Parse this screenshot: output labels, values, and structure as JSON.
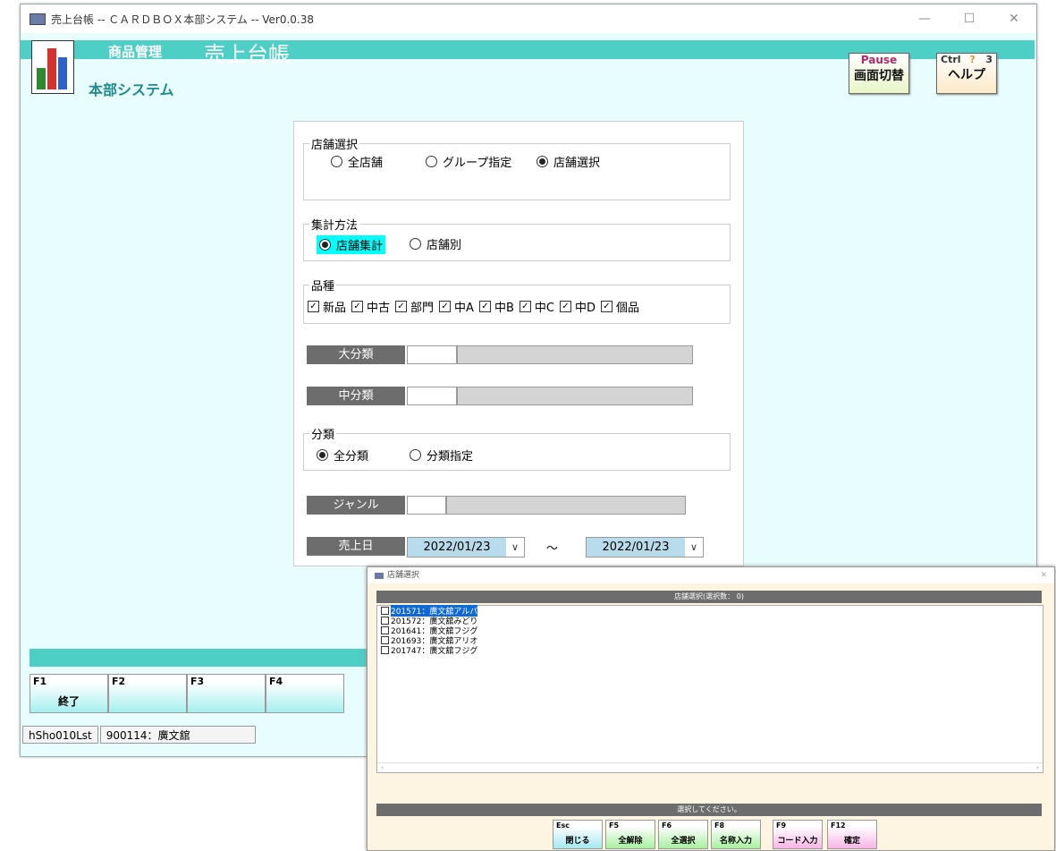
{
  "window": {
    "title": "売上台帳 -- ＣＡＲＤＢＯＸ本部システム -- Ver0.0.38",
    "min": "—",
    "max": "☐",
    "close": "✕"
  },
  "header": {
    "category": "商品管理",
    "title": "売上台帳",
    "subtitle": "本部システム",
    "screen_switch": {
      "key": "Pause",
      "label": "画面切替"
    },
    "help": {
      "key": "Ctrl",
      "num": "3",
      "label": "ヘルプ"
    }
  },
  "store_select": {
    "legend": "店舗選択",
    "options": [
      "全店舗",
      "グループ指定",
      "店舗選択"
    ],
    "selected": "店舗選択"
  },
  "aggregation": {
    "legend": "集計方法",
    "options": [
      "店舗集計",
      "店舗別"
    ],
    "selected": "店舗集計"
  },
  "product_type": {
    "legend": "品種",
    "items": [
      "新品",
      "中古",
      "部門",
      "中A",
      "中B",
      "中C",
      "中D",
      "個品"
    ]
  },
  "fields": {
    "major_class": "大分類",
    "middle_class": "中分類",
    "genre": "ジャンル",
    "sales_date": "売上日",
    "date_from": "2022/01/23",
    "date_to": "2022/01/23",
    "tilde": "～"
  },
  "classification": {
    "legend": "分類",
    "options": [
      "全分類",
      "分類指定"
    ],
    "selected": "全分類"
  },
  "fkeys": [
    {
      "num": "F1",
      "label": "終了"
    },
    {
      "num": "F2",
      "label": ""
    },
    {
      "num": "F3",
      "label": ""
    },
    {
      "num": "F4",
      "label": ""
    }
  ],
  "status": {
    "program": "hSho010Lst",
    "store": "900114：廣文舘"
  },
  "dialog": {
    "title": "店舗選択",
    "header": "店舗選択(選択数： 0)",
    "items": [
      "201571：廣文舘アルパ",
      "201572：廣文舘みどり",
      "201641：廣文舘フジグ",
      "201693：廣文舘アリオ",
      "201747：廣文舘フジグ"
    ],
    "message": "選択してください。",
    "keys": [
      {
        "num": "Esc",
        "label": "閉じる",
        "color": "#a6e8f2"
      },
      {
        "num": "F5",
        "label": "全解除",
        "color": "#a9f0a0"
      },
      {
        "num": "F6",
        "label": "全選択",
        "color": "#a9f0a0"
      },
      {
        "num": "F8",
        "label": "名称入力",
        "color": "#a9f0a0"
      },
      {
        "num": "F9",
        "label": "コード入力",
        "color": "#f7b6e6"
      },
      {
        "num": "F12",
        "label": "確定",
        "color": "#f7b6e6"
      }
    ]
  },
  "colors": {
    "accent": "#4ecfc6",
    "label_bg": "#6d6d6d",
    "highlight": "#00ffff"
  }
}
